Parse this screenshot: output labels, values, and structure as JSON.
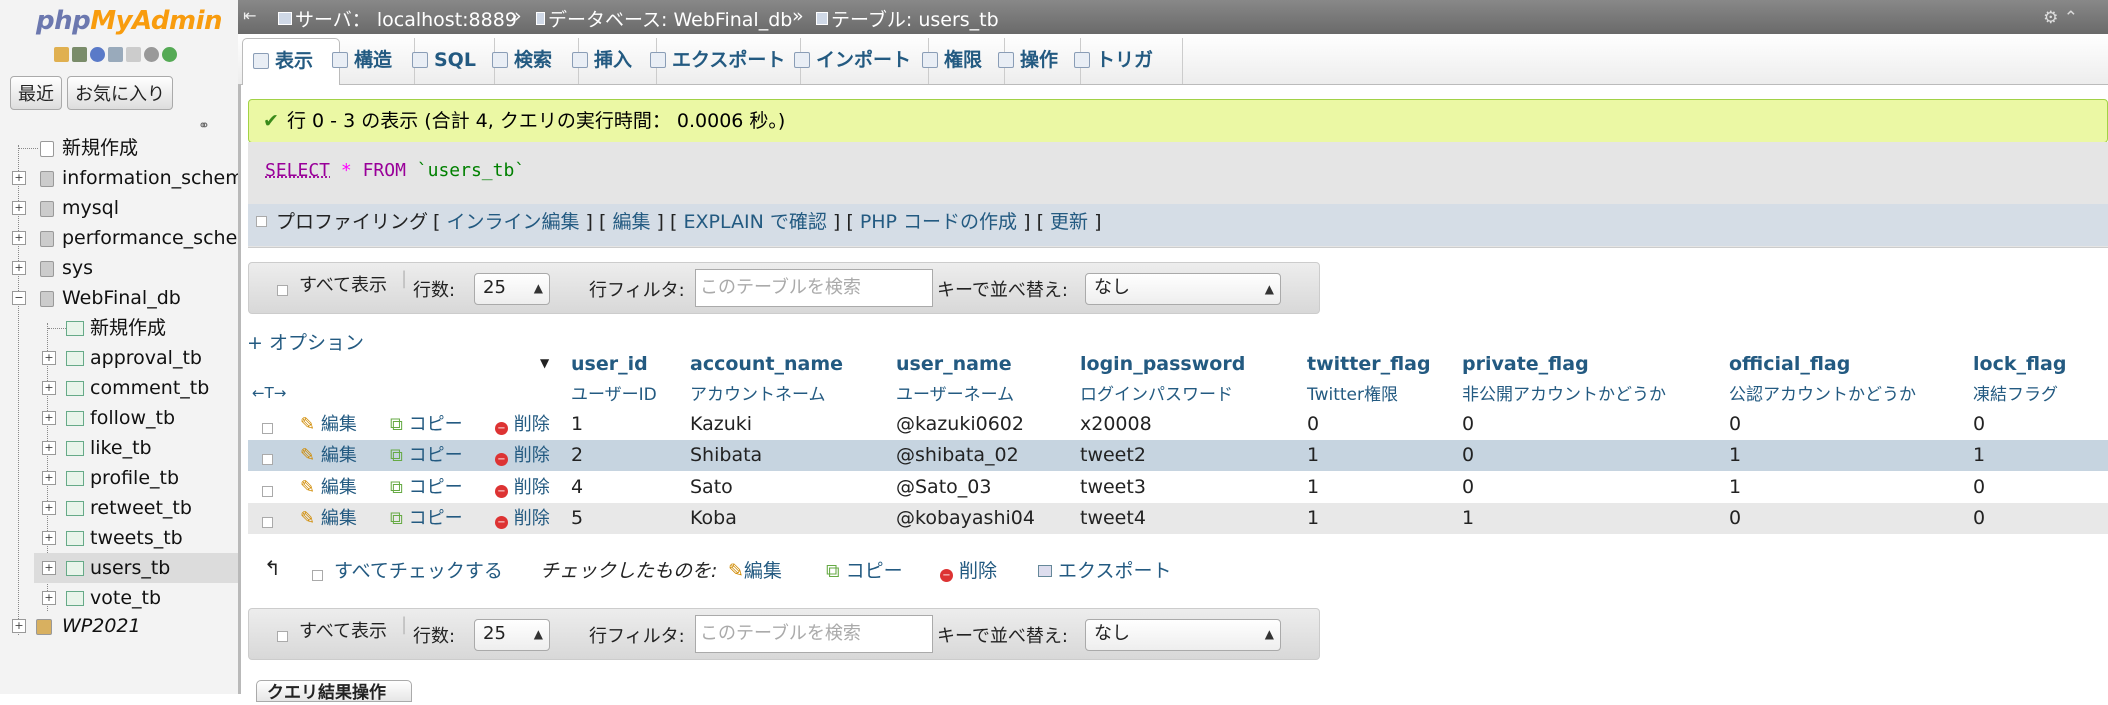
{
  "app": {
    "logo_part1": "php",
    "logo_part2": "MyAdmin"
  },
  "nav": {
    "recent_btn": "最近",
    "favorites_btn": "お気に入り",
    "tree": [
      {
        "label": "新規作成",
        "kind": "new"
      },
      {
        "label": "information_schema",
        "kind": "db"
      },
      {
        "label": "mysql",
        "kind": "db"
      },
      {
        "label": "performance_schema",
        "kind": "db"
      },
      {
        "label": "sys",
        "kind": "db"
      },
      {
        "label": "WebFinal_db",
        "kind": "db"
      },
      {
        "label": "新規作成",
        "kind": "new"
      },
      {
        "label": "approval_tb",
        "kind": "table"
      },
      {
        "label": "comment_tb",
        "kind": "table"
      },
      {
        "label": "follow_tb",
        "kind": "table"
      },
      {
        "label": "like_tb",
        "kind": "table"
      },
      {
        "label": "profile_tb",
        "kind": "table"
      },
      {
        "label": "retweet_tb",
        "kind": "table"
      },
      {
        "label": "tweets_tb",
        "kind": "table"
      },
      {
        "label": "users_tb",
        "kind": "table",
        "selected": true
      },
      {
        "label": "vote_tb",
        "kind": "table"
      },
      {
        "label": "WP2021",
        "kind": "group"
      }
    ]
  },
  "breadcrumb": {
    "server_label": "サーバ：",
    "server": "localhost:8889",
    "database_label": "データベース:",
    "database": "WebFinal_db",
    "table_label": "テーブル:",
    "table": "users_tb"
  },
  "tabs": [
    {
      "label": "表示",
      "active": true
    },
    {
      "label": "構造"
    },
    {
      "label": "SQL"
    },
    {
      "label": "検索"
    },
    {
      "label": "挿入"
    },
    {
      "label": "エクスポート"
    },
    {
      "label": "インポート"
    },
    {
      "label": "権限"
    },
    {
      "label": "操作"
    },
    {
      "label": "トリガ"
    }
  ],
  "success": {
    "message": "行 0 - 3 の表示 (合計 4, クエリの実行時間： 0.0006 秒。)"
  },
  "sql": {
    "select": "SELECT",
    "star": "*",
    "from": "FROM",
    "table": "`users_tb`",
    "profiling": "プロファイリング",
    "open_bracket": "[",
    "close_bracket": "]",
    "inline_edit": "インライン編集",
    "edit": "編集",
    "explain": "EXPLAIN で確認",
    "php_code": "PHP コードの作成",
    "refresh": "更新"
  },
  "filter": {
    "show_all": "すべて表示",
    "rows_label": "行数:",
    "rows_value": "25",
    "row_filter_label": "行フィルタ:",
    "search_placeholder": "このテーブルを検索",
    "sort_label": "キーで並べ替え:",
    "sort_value": "なし"
  },
  "options_link": "+ オプション",
  "table": {
    "arrows": "←T→",
    "columns": [
      {
        "name": "user_id",
        "comment": "ユーザーID"
      },
      {
        "name": "account_name",
        "comment": "アカウントネーム"
      },
      {
        "name": "user_name",
        "comment": "ユーザーネーム"
      },
      {
        "name": "login_password",
        "comment": "ログインパスワード"
      },
      {
        "name": "twitter_flag",
        "comment": "Twitter権限"
      },
      {
        "name": "private_flag",
        "comment": "非公開アカウントかどうか"
      },
      {
        "name": "official_flag",
        "comment": "公認アカウントかどうか"
      },
      {
        "name": "lock_flag",
        "comment": "凍結フラグ"
      }
    ],
    "actions": {
      "edit": "編集",
      "copy": "コピー",
      "delete": "削除"
    },
    "rows": [
      [
        "1",
        "Kazuki",
        "@kazuki0602",
        "x20008",
        "0",
        "0",
        "0",
        "0"
      ],
      [
        "2",
        "Shibata",
        "@shibata_02",
        "tweet2",
        "1",
        "0",
        "1",
        "1"
      ],
      [
        "4",
        "Sato",
        "@Sato_03",
        "tweet3",
        "1",
        "0",
        "1",
        "0"
      ],
      [
        "5",
        "Koba",
        "@kobayashi04",
        "tweet4",
        "1",
        "1",
        "0",
        "0"
      ]
    ]
  },
  "bulk": {
    "check_all": "すべてチェックする",
    "with_selected": "チェックしたものを:",
    "edit": "編集",
    "copy": "コピー",
    "delete": "削除",
    "export": "エクスポート"
  },
  "query_results_ops": "クエリ結果操作",
  "colors": {
    "link": "#235a81",
    "success_bg": "#ebf8a4",
    "marked_row": "#c6d4e0"
  }
}
